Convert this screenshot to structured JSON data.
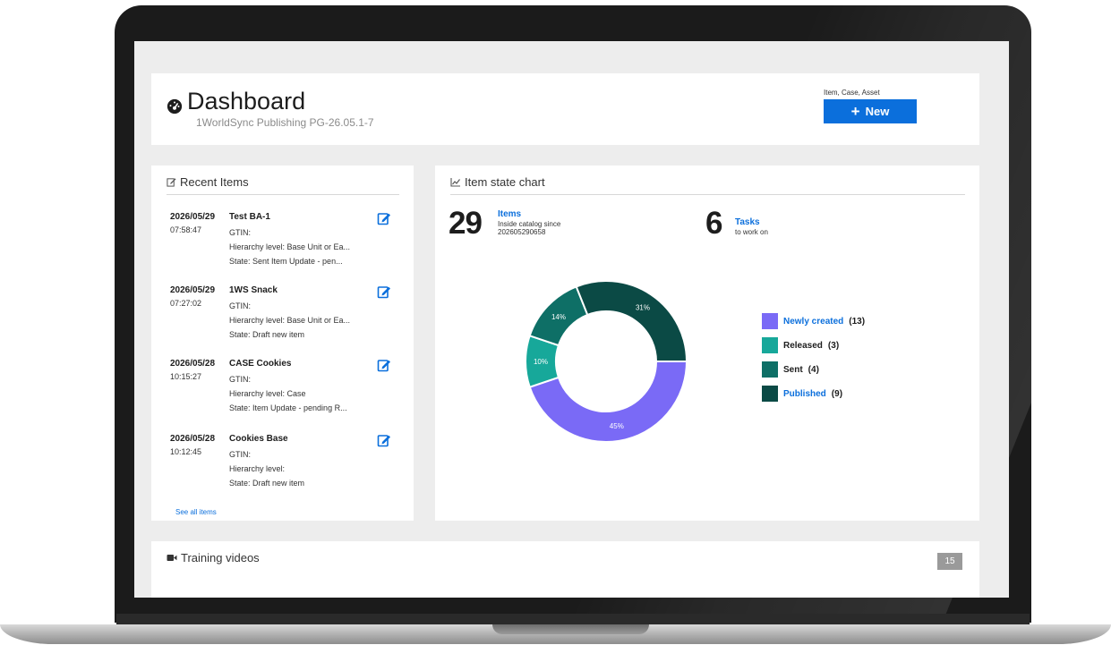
{
  "header": {
    "title": "Dashboard",
    "subtitle": "1WorldSync Publishing PG-26.05.1-7",
    "new_caption": "Item, Case, Asset",
    "new_button_label": "New",
    "icon": "dashboard-gauge-icon"
  },
  "recent_items": {
    "title": "Recent Items",
    "icon": "edit-icon",
    "items": [
      {
        "date": "2026/05/29",
        "time": "07:58:47",
        "name": "Test BA-1",
        "gtin": "GTIN:",
        "hierarchy": "Hierarchy level: Base Unit or Ea...",
        "state": "State: Sent Item Update - pen..."
      },
      {
        "date": "2026/05/29",
        "time": "07:27:02",
        "name": "1WS Snack",
        "gtin": "GTIN:",
        "hierarchy": "Hierarchy level: Base Unit or Ea...",
        "state": "State: Draft new item"
      },
      {
        "date": "2026/05/28",
        "time": "10:15:27",
        "name": "CASE Cookies",
        "gtin": "GTIN:",
        "hierarchy": "Hierarchy level: Case",
        "state": "State: Item Update - pending R..."
      },
      {
        "date": "2026/05/28",
        "time": "10:12:45",
        "name": "Cookies Base",
        "gtin": "GTIN:",
        "hierarchy": "Hierarchy level:",
        "state": "State: Draft new item"
      }
    ],
    "see_all": "See all items"
  },
  "item_state_chart": {
    "title": "Item state chart",
    "icon": "line-chart-icon",
    "items_count": "29",
    "items_label": "Items",
    "items_sub_1": "Inside catalog since",
    "items_sub_2": "202605290658",
    "tasks_count": "6",
    "tasks_label": "Tasks",
    "tasks_sub": "to work on"
  },
  "chart_data": {
    "type": "pie",
    "categories": [
      "Newly created",
      "Released",
      "Sent",
      "Published"
    ],
    "values": [
      13,
      3,
      4,
      9
    ],
    "value_labels": [
      "45%",
      "10%",
      "14%",
      "31%"
    ],
    "colors": [
      "#7a6af6",
      "#17a89a",
      "#0e6f66",
      "#0b4a45"
    ],
    "legend": [
      {
        "name": "Newly created",
        "count": "(13)",
        "link": true
      },
      {
        "name": "Released",
        "count": "(3)",
        "link": false
      },
      {
        "name": "Sent",
        "count": "(4)",
        "link": false
      },
      {
        "name": "Published",
        "count": "(9)",
        "link": true
      }
    ],
    "legend_position": "right",
    "donut": true
  },
  "training": {
    "title": "Training videos",
    "icon": "video-camera-icon",
    "count": "15"
  }
}
